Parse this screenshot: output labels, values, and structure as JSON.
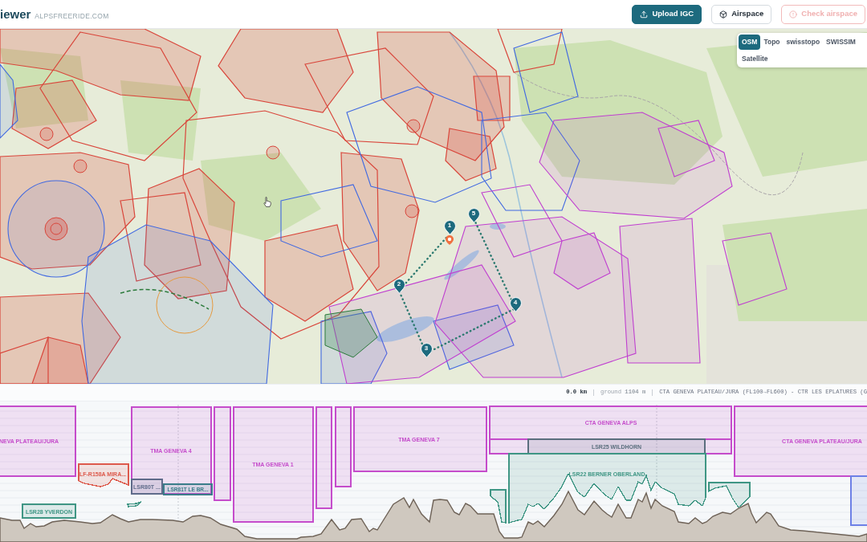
{
  "header": {
    "app_title": "iewer",
    "site": "ALPSFREERIDE.COM",
    "buttons": [
      {
        "label": "Upload IGC",
        "kind": "primary",
        "disabled": false
      },
      {
        "label": "Airspace",
        "kind": "outline",
        "disabled": false
      },
      {
        "label": "Check airspace",
        "kind": "warning",
        "disabled": true
      }
    ]
  },
  "map": {
    "layers": [
      {
        "label": "OSM",
        "selected": true
      },
      {
        "label": "Topo",
        "selected": false
      },
      {
        "label": "swisstopo",
        "selected": false
      },
      {
        "label": "SWISSIM",
        "selected": false
      },
      {
        "label": "Satellite",
        "selected": false
      }
    ],
    "waypoints": [
      "1",
      "2",
      "3",
      "4",
      "5"
    ]
  },
  "profile_info": {
    "distance": "0.0 km",
    "ground": "ground **1104 m**",
    "airspaces": "CTA GENEVA PLATEAU/JURA (FL100→FL600) - CTR LES EPLATURES (G"
  },
  "profile": {
    "airspaces": [
      {
        "label": "NEVA PLATEAU/JURA",
        "color": "#c54ccb"
      },
      {
        "label": "LSR28 YVERDON",
        "color": "#3f9684"
      },
      {
        "label": "LF-R158A MIRA...",
        "color": "#dd5a4c"
      },
      {
        "color": "#3f9684"
      },
      {
        "label": "TMA GENEVA 4",
        "color": "#c54ccb"
      },
      {
        "label": "LSR80T ...",
        "color": "#5f6b8a"
      },
      {
        "label": "LSR81T LE BR...",
        "color": "#3b7d8a"
      },
      {
        "color": "#c54ccb"
      },
      {
        "label": "TMA GENEVA 1",
        "color": "#c54ccb"
      },
      {
        "color": "#c54ccb"
      },
      {
        "color": "#c54ccb"
      },
      {
        "label": "TMA GENEVA 7",
        "color": "#c54ccb"
      },
      {
        "label": "CTA GENEVA ALPS",
        "color": "#c54ccb"
      },
      {
        "color": "#c54ccb"
      },
      {
        "label": "LSR25 WILDHORN",
        "color": "#5b6f7e"
      },
      {
        "color": "#3f9684"
      },
      {
        "label": "LSR22 BERNER OBERLAND",
        "color": "#3f9684"
      },
      {
        "color": "#3f9684"
      },
      {
        "label": "CTA GENEVA PLATEAU/JURA",
        "color": "#c54ccb"
      },
      {
        "color": "#6d80e6"
      }
    ]
  }
}
